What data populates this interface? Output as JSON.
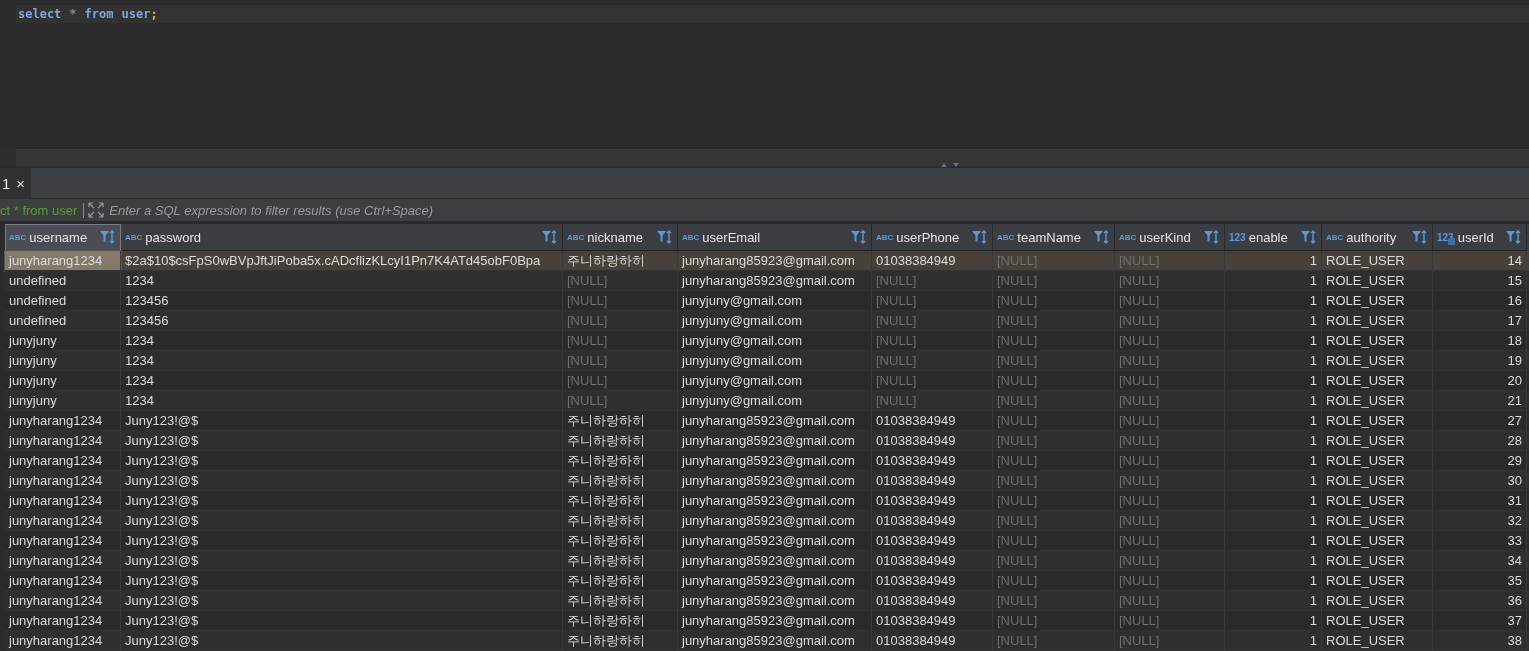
{
  "editor": {
    "sql": [
      {
        "kind": "keyword",
        "text": "select"
      },
      {
        "kind": "operator",
        "text": "*"
      },
      {
        "kind": "keyword",
        "text": "from"
      },
      {
        "kind": "keyword",
        "text": "user"
      },
      {
        "kind": "punct",
        "text": ";"
      }
    ]
  },
  "results_tab": {
    "label": "1",
    "close": "×",
    "selected": true
  },
  "filter": {
    "query": "ct * from user",
    "placeholder": "Enter a SQL expression to filter results (use Ctrl+Space)"
  },
  "table": {
    "columns": [
      {
        "name": "username",
        "type": "ABC",
        "kind": "text",
        "selected": true
      },
      {
        "name": "password",
        "type": "ABC",
        "kind": "text",
        "selected": false
      },
      {
        "name": "nickname",
        "type": "ABC",
        "kind": "text",
        "selected": false
      },
      {
        "name": "userEmail",
        "type": "ABC",
        "kind": "text",
        "selected": false
      },
      {
        "name": "userPhone",
        "type": "ABC",
        "kind": "text",
        "selected": false
      },
      {
        "name": "teamName",
        "type": "ABC",
        "kind": "text",
        "selected": false
      },
      {
        "name": "userKind",
        "type": "ABC",
        "kind": "text",
        "selected": false
      },
      {
        "name": "enable",
        "type": "123",
        "kind": "number",
        "selected": false
      },
      {
        "name": "authority",
        "type": "ABC",
        "kind": "text",
        "selected": false
      },
      {
        "name": "userId",
        "type": "123",
        "kind": "key",
        "selected": false
      }
    ],
    "rows": [
      {
        "selected": true,
        "cells": [
          {
            "text": "junyharang1234",
            "focused": true
          },
          "$2a$10$csFpS0wBVpJftJiPoba5x.cADcflizKLcyI1Pn7K4ATd45obF0Bpa",
          "주니하랑하히",
          "junyharang85923@gmail.com",
          "01038384949",
          {
            "text": "[NULL]",
            "null": true
          },
          {
            "text": "[NULL]",
            "null": true
          },
          "1",
          "ROLE_USER",
          "14"
        ]
      },
      {
        "selected": false,
        "cells": [
          "undefined",
          "1234",
          {
            "text": "[NULL]",
            "null": true
          },
          "junyharang85923@gmail.com",
          {
            "text": "[NULL]",
            "null": true
          },
          {
            "text": "[NULL]",
            "null": true
          },
          {
            "text": "[NULL]",
            "null": true
          },
          "1",
          "ROLE_USER",
          "15"
        ]
      },
      {
        "selected": false,
        "cells": [
          "undefined",
          "123456",
          {
            "text": "[NULL]",
            "null": true
          },
          "junyjuny@gmail.com",
          {
            "text": "[NULL]",
            "null": true
          },
          {
            "text": "[NULL]",
            "null": true
          },
          {
            "text": "[NULL]",
            "null": true
          },
          "1",
          "ROLE_USER",
          "16"
        ]
      },
      {
        "selected": false,
        "cells": [
          "undefined",
          "123456",
          {
            "text": "[NULL]",
            "null": true
          },
          "junyjuny@gmail.com",
          {
            "text": "[NULL]",
            "null": true
          },
          {
            "text": "[NULL]",
            "null": true
          },
          {
            "text": "[NULL]",
            "null": true
          },
          "1",
          "ROLE_USER",
          "17"
        ]
      },
      {
        "selected": false,
        "cells": [
          "junyjuny",
          "1234",
          {
            "text": "[NULL]",
            "null": true
          },
          "junyjuny@gmail.com",
          {
            "text": "[NULL]",
            "null": true
          },
          {
            "text": "[NULL]",
            "null": true
          },
          {
            "text": "[NULL]",
            "null": true
          },
          "1",
          "ROLE_USER",
          "18"
        ]
      },
      {
        "selected": false,
        "cells": [
          "junyjuny",
          "1234",
          {
            "text": "[NULL]",
            "null": true
          },
          "junyjuny@gmail.com",
          {
            "text": "[NULL]",
            "null": true
          },
          {
            "text": "[NULL]",
            "null": true
          },
          {
            "text": "[NULL]",
            "null": true
          },
          "1",
          "ROLE_USER",
          "19"
        ]
      },
      {
        "selected": false,
        "cells": [
          "junyjuny",
          "1234",
          {
            "text": "[NULL]",
            "null": true
          },
          "junyjuny@gmail.com",
          {
            "text": "[NULL]",
            "null": true
          },
          {
            "text": "[NULL]",
            "null": true
          },
          {
            "text": "[NULL]",
            "null": true
          },
          "1",
          "ROLE_USER",
          "20"
        ]
      },
      {
        "selected": false,
        "cells": [
          "junyjuny",
          "1234",
          {
            "text": "[NULL]",
            "null": true
          },
          "junyjuny@gmail.com",
          {
            "text": "[NULL]",
            "null": true
          },
          {
            "text": "[NULL]",
            "null": true
          },
          {
            "text": "[NULL]",
            "null": true
          },
          "1",
          "ROLE_USER",
          "21"
        ]
      },
      {
        "selected": false,
        "cells": [
          "junyharang1234",
          "Juny123!@$",
          "주니하랑하히",
          "junyharang85923@gmail.com",
          "01038384949",
          {
            "text": "[NULL]",
            "null": true
          },
          {
            "text": "[NULL]",
            "null": true
          },
          "1",
          "ROLE_USER",
          "27"
        ]
      },
      {
        "selected": false,
        "cells": [
          "junyharang1234",
          "Juny123!@$",
          "주니하랑하히",
          "junyharang85923@gmail.com",
          "01038384949",
          {
            "text": "[NULL]",
            "null": true
          },
          {
            "text": "[NULL]",
            "null": true
          },
          "1",
          "ROLE_USER",
          "28"
        ]
      },
      {
        "selected": false,
        "cells": [
          "junyharang1234",
          "Juny123!@$",
          "주니하랑하히",
          "junyharang85923@gmail.com",
          "01038384949",
          {
            "text": "[NULL]",
            "null": true
          },
          {
            "text": "[NULL]",
            "null": true
          },
          "1",
          "ROLE_USER",
          "29"
        ]
      },
      {
        "selected": false,
        "cells": [
          "junyharang1234",
          "Juny123!@$",
          "주니하랑하히",
          "junyharang85923@gmail.com",
          "01038384949",
          {
            "text": "[NULL]",
            "null": true
          },
          {
            "text": "[NULL]",
            "null": true
          },
          "1",
          "ROLE_USER",
          "30"
        ]
      },
      {
        "selected": false,
        "cells": [
          "junyharang1234",
          "Juny123!@$",
          "주니하랑하히",
          "junyharang85923@gmail.com",
          "01038384949",
          {
            "text": "[NULL]",
            "null": true
          },
          {
            "text": "[NULL]",
            "null": true
          },
          "1",
          "ROLE_USER",
          "31"
        ]
      },
      {
        "selected": false,
        "cells": [
          "junyharang1234",
          "Juny123!@$",
          "주니하랑하히",
          "junyharang85923@gmail.com",
          "01038384949",
          {
            "text": "[NULL]",
            "null": true
          },
          {
            "text": "[NULL]",
            "null": true
          },
          "1",
          "ROLE_USER",
          "32"
        ]
      },
      {
        "selected": false,
        "cells": [
          "junyharang1234",
          "Juny123!@$",
          "주니하랑하히",
          "junyharang85923@gmail.com",
          "01038384949",
          {
            "text": "[NULL]",
            "null": true
          },
          {
            "text": "[NULL]",
            "null": true
          },
          "1",
          "ROLE_USER",
          "33"
        ]
      },
      {
        "selected": false,
        "cells": [
          "junyharang1234",
          "Juny123!@$",
          "주니하랑하히",
          "junyharang85923@gmail.com",
          "01038384949",
          {
            "text": "[NULL]",
            "null": true
          },
          {
            "text": "[NULL]",
            "null": true
          },
          "1",
          "ROLE_USER",
          "34"
        ]
      },
      {
        "selected": false,
        "cells": [
          "junyharang1234",
          "Juny123!@$",
          "주니하랑하히",
          "junyharang85923@gmail.com",
          "01038384949",
          {
            "text": "[NULL]",
            "null": true
          },
          {
            "text": "[NULL]",
            "null": true
          },
          "1",
          "ROLE_USER",
          "35"
        ]
      },
      {
        "selected": false,
        "cells": [
          "junyharang1234",
          "Juny123!@$",
          "주니하랑하히",
          "junyharang85923@gmail.com",
          "01038384949",
          {
            "text": "[NULL]",
            "null": true
          },
          {
            "text": "[NULL]",
            "null": true
          },
          "1",
          "ROLE_USER",
          "36"
        ]
      },
      {
        "selected": false,
        "cells": [
          "junyharang1234",
          "Juny123!@$",
          "주니하랑하히",
          "junyharang85923@gmail.com",
          "01038384949",
          {
            "text": "[NULL]",
            "null": true
          },
          {
            "text": "[NULL]",
            "null": true
          },
          "1",
          "ROLE_USER",
          "37"
        ]
      },
      {
        "selected": false,
        "cells": [
          "junyharang1234",
          "Juny123!@$",
          "주니하랑하히",
          "junyharang85923@gmail.com",
          "01038384949",
          {
            "text": "[NULL]",
            "null": true
          },
          {
            "text": "[NULL]",
            "null": true
          },
          "1",
          "ROLE_USER",
          "38"
        ]
      }
    ]
  }
}
